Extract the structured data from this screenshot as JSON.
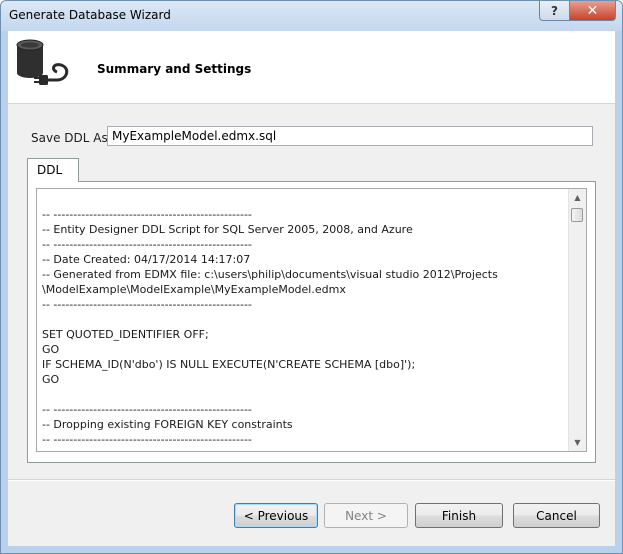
{
  "window": {
    "title": "Generate Database Wizard",
    "help_label": "?",
    "close_label": "✕"
  },
  "header": {
    "title": "Summary and Settings",
    "icon": "database-plug-icon"
  },
  "save_ddl": {
    "label": "Save DDL As:",
    "value": "MyExampleModel.edmx.sql"
  },
  "tabs": [
    {
      "label": "DDL",
      "selected": true
    }
  ],
  "editor": {
    "lines": [
      "-- --------------------------------------------------",
      "-- Entity Designer DDL Script for SQL Server 2005, 2008, and Azure",
      "-- --------------------------------------------------",
      "-- Date Created: 04/17/2014 14:17:07",
      "-- Generated from EDMX file: c:\\users\\philip\\documents\\visual studio 2012\\Projects",
      "\\ModelExample\\ModelExample\\MyExampleModel.edmx",
      "-- --------------------------------------------------",
      "",
      "SET QUOTED_IDENTIFIER OFF;",
      "GO",
      "IF SCHEMA_ID(N'dbo') IS NULL EXECUTE(N'CREATE SCHEMA [dbo]');",
      "GO",
      "",
      "-- --------------------------------------------------",
      "-- Dropping existing FOREIGN KEY constraints",
      "-- --------------------------------------------------"
    ]
  },
  "buttons": {
    "previous": "< Previous",
    "next": "Next >",
    "finish": "Finish",
    "cancel": "Cancel"
  }
}
